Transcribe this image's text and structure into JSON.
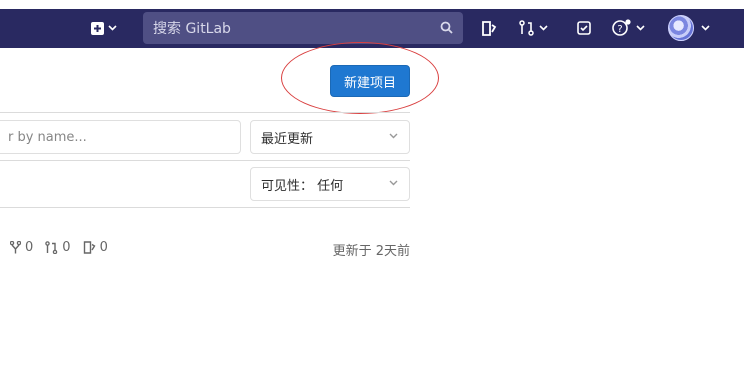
{
  "header": {
    "search_placeholder": "搜索 GitLab"
  },
  "page": {
    "new_project_button": "新建项目",
    "filter_placeholder": "r by name...",
    "sort_dropdown": "最近更新",
    "visibility_dropdown": "可见性： 任何"
  },
  "project": {
    "forks": "0",
    "merge_requests": "0",
    "issues": "0",
    "updated": "更新于 2天前"
  },
  "colors": {
    "navbar": "#292961",
    "primary_button": "#1f78d1",
    "annotation_circle": "#d94040"
  }
}
